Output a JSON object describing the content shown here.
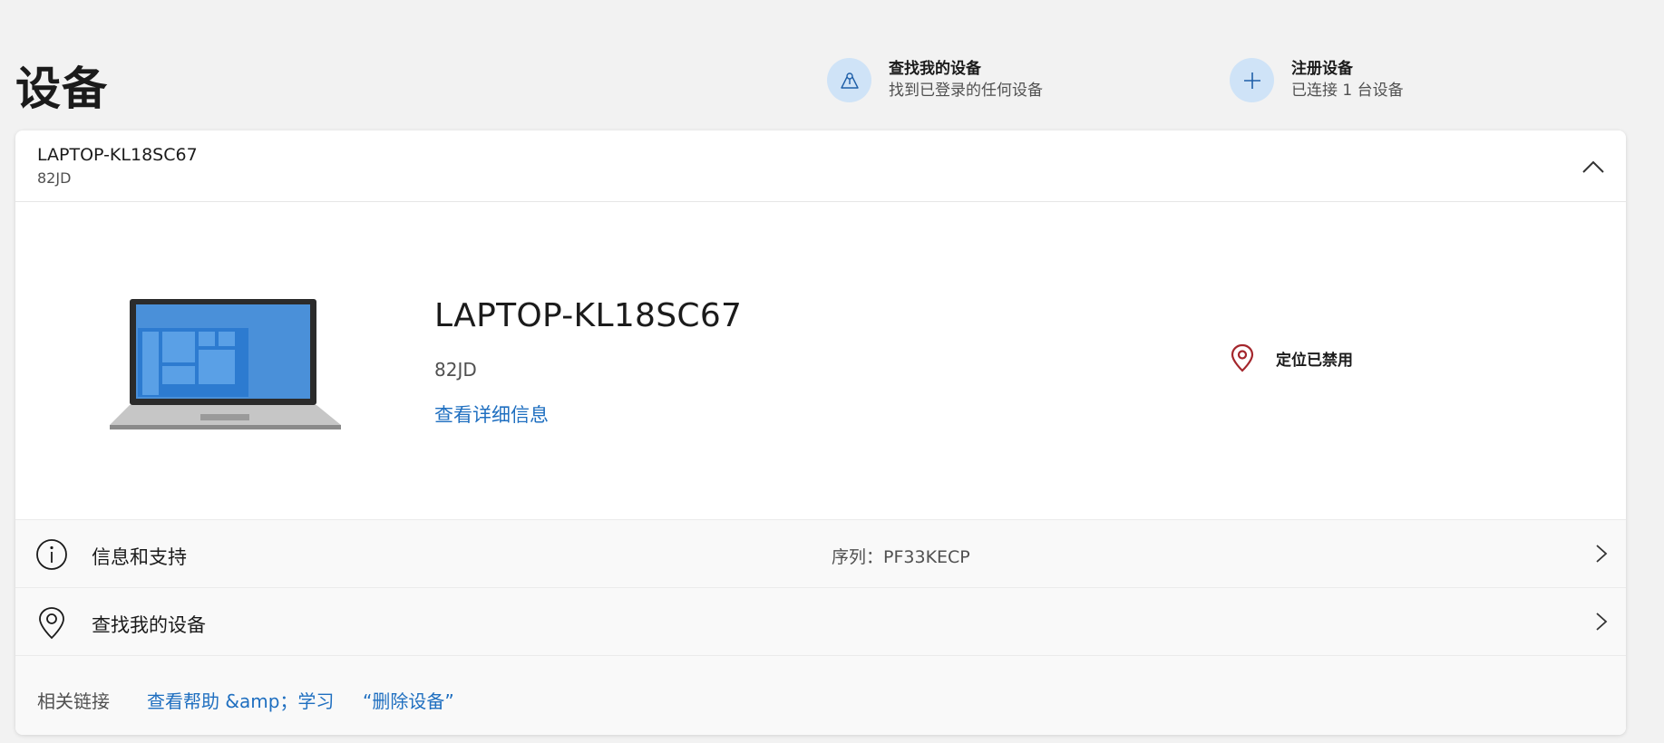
{
  "page": {
    "title": "设备"
  },
  "quick_actions": [
    {
      "title": "查找我的设备",
      "subtitle": "找到已登录的任何设备",
      "icon": "find-device-icon"
    },
    {
      "title": "注册设备",
      "subtitle": "已连接 1 台设备",
      "icon": "plus-icon"
    }
  ],
  "device": {
    "header_name": "LAPTOP-KL18SC67",
    "header_model": "82JD",
    "name": "LAPTOP-KL18SC67",
    "model": "82JD",
    "details_link": "查看详细信息",
    "location_status": "定位已禁用"
  },
  "rows": [
    {
      "label": "信息和支持",
      "value": "序列：PF33KECP",
      "icon": "info-icon"
    },
    {
      "label": "查找我的设备",
      "value": "",
      "icon": "location-pin-icon"
    }
  ],
  "related": {
    "label": "相关链接",
    "links": [
      "查看帮助 &amp；学习",
      "“删除设备”"
    ]
  },
  "colors": {
    "background": "#f2f2f2",
    "card": "#ffffff",
    "link": "#1f6fc0",
    "icon_circle": "#cfe3f7",
    "location_disabled": "#a4262c"
  }
}
